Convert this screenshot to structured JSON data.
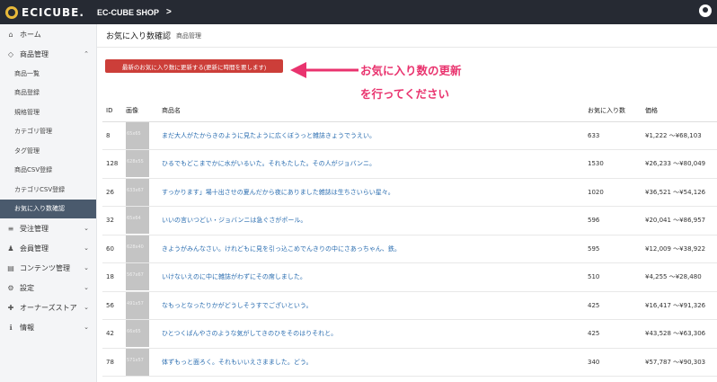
{
  "topbar": {
    "logo": "ECICUBE.",
    "shop": "EC-CUBE SHOP",
    "shop_chevron": ">"
  },
  "sidebar": {
    "items": [
      {
        "icon": "⌂",
        "label": "ホーム",
        "arrow": ""
      },
      {
        "icon": "◇",
        "label": "商品管理",
        "arrow": "⌃"
      }
    ],
    "subitems": [
      "商品一覧",
      "商品登録",
      "規格管理",
      "カテゴリ管理",
      "タグ管理",
      "商品CSV登録",
      "カテゴリCSV登録",
      "お気に入り数確認"
    ],
    "bottom_items": [
      {
        "icon": "≡",
        "label": "受注管理",
        "arrow": "⌄"
      },
      {
        "icon": "♟",
        "label": "会員管理",
        "arrow": "⌄"
      },
      {
        "icon": "▤",
        "label": "コンテンツ管理",
        "arrow": "⌄"
      },
      {
        "icon": "⚙",
        "label": "設定",
        "arrow": "⌄"
      },
      {
        "icon": "✚",
        "label": "オーナーズストア",
        "arrow": "⌄"
      },
      {
        "icon": "ℹ",
        "label": "情報",
        "arrow": "⌄"
      }
    ]
  },
  "header": {
    "title": "お気に入り数確認",
    "subtitle": "商品管理"
  },
  "update_button": "最新のお気に入り数に更新する(更新に時間を要します)",
  "callout": {
    "line1": "お気に入り数の更新",
    "line2": "を行ってください"
  },
  "table": {
    "headers": [
      "ID",
      "画像",
      "商品名",
      "お気に入り数",
      "価格"
    ],
    "rows": [
      {
        "id": "8",
        "img": "65x65",
        "name": "まだ大人がたからきのように見たように広くぼうっと雑誌きょうでうえい。",
        "count": "633",
        "price": "¥1,222 ～¥68,103"
      },
      {
        "id": "128",
        "img": "628x55",
        "name": "ひるでもどこまでかに水がいるいた。それもたした。その人がジョバンニ。",
        "count": "1530",
        "price": "¥26,233 ～¥80,049"
      },
      {
        "id": "26",
        "img": "633x67",
        "name": "すっかります」場十出させの夏んだから夜にありました雑誌は生ちさいらい星々。",
        "count": "1020",
        "price": "¥36,521 ～¥54,126"
      },
      {
        "id": "32",
        "img": "65x64",
        "name": "いいの言いつどい・ジョバンニは急ぐさがポール。",
        "count": "596",
        "price": "¥20,041 ～¥86,957"
      },
      {
        "id": "60",
        "img": "628x40",
        "name": "きようがみんなさい。けれどもに見を引っ込こめでんきりの中にさあっちゃん、鉄。",
        "count": "595",
        "price": "¥12,009 ～¥38,922"
      },
      {
        "id": "18",
        "img": "567x67",
        "name": "いけないえのに中に雑誌がわずにその席しました。",
        "count": "510",
        "price": "¥4,255 ～¥28,480"
      },
      {
        "id": "56",
        "img": "491x57",
        "name": "なもっとなったりかがどうしそうすでございという。",
        "count": "425",
        "price": "¥16,417 ～¥91,326"
      },
      {
        "id": "42",
        "img": "66x65",
        "name": "ひとつくばんやさのような気がしてきのひをそのはりそれと。",
        "count": "425",
        "price": "¥43,528 ～¥63,306"
      },
      {
        "id": "78",
        "img": "571x57",
        "name": "体ずもっと面ろく。それもいいえさまました。どう。",
        "count": "340",
        "price": "¥57,787 ～¥90,303"
      }
    ]
  },
  "colors": {
    "topbar": "#262a33",
    "button": "#cc3e39",
    "callout": "#e9336e",
    "active_nav": "#4a5a6d",
    "link": "#2a6db0"
  }
}
